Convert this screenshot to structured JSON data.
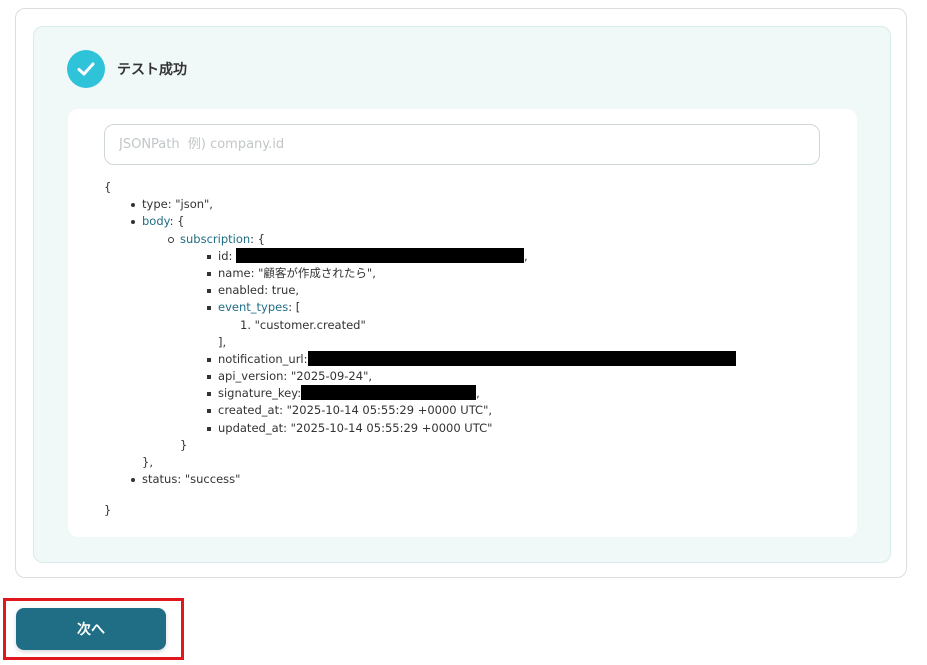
{
  "result": {
    "title": "テスト成功",
    "icon": "check-icon",
    "icon_color": "#2ec3d9"
  },
  "search": {
    "placeholder": "JSONPath  例) company.id",
    "value": ""
  },
  "json_tree": {
    "open_brace": "{",
    "close_brace": "}",
    "type_line": "type: \"json\",",
    "body_key": "body",
    "body_suffix": ": {",
    "subscription_key": "subscription",
    "subscription_suffix": ": {",
    "id_label": "id:",
    "id_tail": ",",
    "name_line": "name: \"顧客が作成されたら\",",
    "enabled_line": "enabled: true,",
    "event_types_key": "event_types",
    "event_types_suffix": ": [",
    "event_item": "1. \"customer.created\"",
    "event_types_close": "],",
    "notification_url_label": "notification_url:",
    "api_version_line": "api_version: \"2025-09-24\",",
    "signature_key_label": "signature_key:",
    "signature_key_tail": ",",
    "created_at_line": "created_at: \"2025-10-14 05:55:29 +0000 UTC\",",
    "updated_at_line": "updated_at: \"2025-10-14 05:55:29 +0000 UTC\"",
    "subscription_close": "}",
    "body_close": "},",
    "status_line": "status: \"success\""
  },
  "footer": {
    "next_label": "次へ",
    "accent": "#1f6e85",
    "highlight_color": "#e1171e"
  }
}
